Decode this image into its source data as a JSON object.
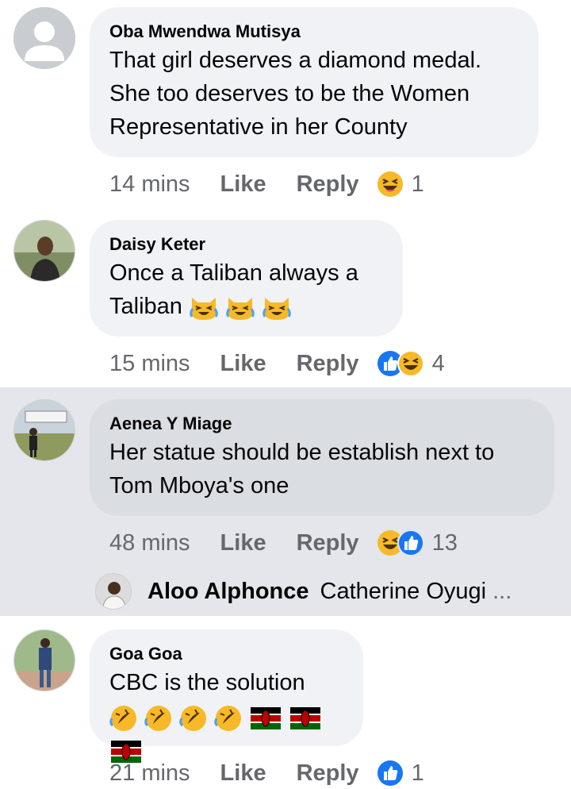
{
  "comments": [
    {
      "name": "Oba Mwendwa Mutisya",
      "lines": [
        "That girl deserves a diamond medal.",
        "She too deserves to be the Women",
        "Representative in her County"
      ],
      "time": "14 mins",
      "like": "Like",
      "reply": "Reply",
      "reaction_count": "1"
    },
    {
      "name": "Daisy Keter",
      "lines": [
        "Once a Taliban always a",
        "Taliban"
      ],
      "time": "15 mins",
      "like": "Like",
      "reply": "Reply",
      "reaction_count": "4"
    },
    {
      "name": "Aenea Y Miage",
      "lines": [
        "Her statue should be establish next to",
        "Tom Mboya's one"
      ],
      "time": "48 mins",
      "like": "Like",
      "reply": "Reply",
      "reaction_count": "13",
      "reply_preview": {
        "name": "Aloo Alphonce",
        "text": "Catherine Oyugi",
        "more": "..."
      }
    },
    {
      "name": "Goa Goa",
      "lines": [
        "CBC is the solution"
      ],
      "time": "21 mins",
      "like": "Like",
      "reply": "Reply",
      "reaction_count": "1"
    }
  ],
  "colors": {
    "bubble": "#f0f2f5",
    "highlight_row": "#e4e6eb",
    "meta_text": "#65676b",
    "like_blue": "#1877f2",
    "haha_yellow": "#f7b928"
  }
}
